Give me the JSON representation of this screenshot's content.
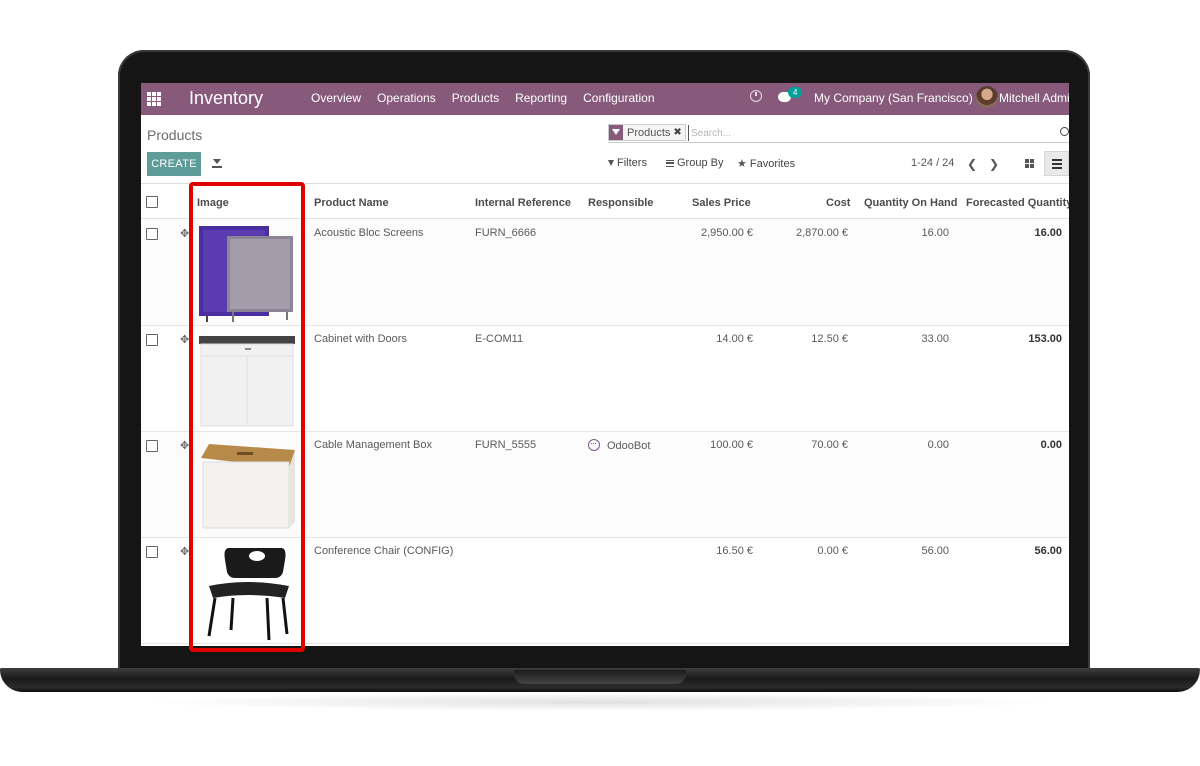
{
  "navbar": {
    "app_name": "Inventory",
    "menu": [
      "Overview",
      "Operations",
      "Products",
      "Reporting",
      "Configuration"
    ],
    "chat_badge": "4",
    "company": "My Company (San Francisco)",
    "user": "Mitchell Admin"
  },
  "control_panel": {
    "breadcrumb": "Products",
    "facet": "Products",
    "search_placeholder": "Search...",
    "create_label": "CREATE",
    "filters_label": "Filters",
    "groupby_label": "Group By",
    "favorites_label": "Favorites",
    "pager": "1-24 / 24"
  },
  "table": {
    "columns": [
      "Image",
      "Product Name",
      "Internal Reference",
      "Responsible",
      "Sales Price",
      "Cost",
      "Quantity On Hand",
      "Forecasted Quantity"
    ],
    "rows": [
      {
        "name": "Acoustic Bloc Screens",
        "ref": "FURN_6666",
        "responsible": "",
        "price": "2,950.00 €",
        "cost": "2,870.00 €",
        "qty": "16.00",
        "forecast": "16.00",
        "image": "acoustic-screens"
      },
      {
        "name": "Cabinet with Doors",
        "ref": "E-COM11",
        "responsible": "",
        "price": "14.00 €",
        "cost": "12.50 €",
        "qty": "33.00",
        "forecast": "153.00",
        "image": "cabinet"
      },
      {
        "name": "Cable Management Box",
        "ref": "FURN_5555",
        "responsible": "OdooBot",
        "price": "100.00 €",
        "cost": "70.00 €",
        "qty": "0.00",
        "forecast": "0.00",
        "image": "cable-box"
      },
      {
        "name": "Conference Chair (CONFIG)",
        "ref": "",
        "responsible": "",
        "price": "16.50 €",
        "cost": "0.00 €",
        "qty": "56.00",
        "forecast": "56.00",
        "image": "chair"
      }
    ]
  },
  "colors": {
    "navbar": "#875a7b",
    "create_button": "#5d9c99",
    "highlight": "#e00000"
  }
}
